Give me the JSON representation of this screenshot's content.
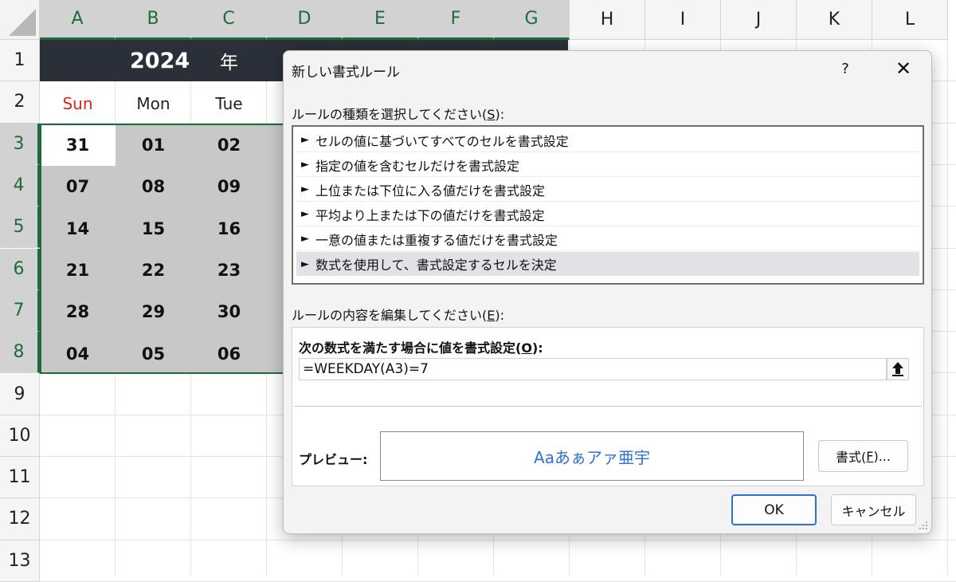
{
  "sheet": {
    "columns": [
      "A",
      "B",
      "C",
      "D",
      "E",
      "F",
      "G",
      "H",
      "I",
      "J",
      "K",
      "L"
    ],
    "rows": [
      "1",
      "2",
      "3",
      "4",
      "5",
      "6",
      "7",
      "8",
      "9",
      "10",
      "11",
      "12",
      "13"
    ],
    "year": "2024",
    "year_suffix": "年",
    "weekdays": [
      "Sun",
      "Mon",
      "Tue"
    ],
    "day_rows": [
      [
        "31",
        "01",
        "02"
      ],
      [
        "07",
        "08",
        "09"
      ],
      [
        "14",
        "15",
        "16"
      ],
      [
        "21",
        "22",
        "23"
      ],
      [
        "28",
        "29",
        "30"
      ],
      [
        "04",
        "05",
        "06"
      ]
    ],
    "colors": {
      "header_band": "#2b2f38",
      "selection": "#1e6b3a",
      "sunday": "#e02020",
      "range_fill": "#c8c8c8"
    }
  },
  "dialog": {
    "title": "新しい書式ルール",
    "help": "?",
    "close": "✕",
    "rule_type_label_pre": "ルールの種類を選択してください(",
    "rule_type_key": "S",
    "rule_type_label_post": "):",
    "rule_types": [
      "セルの値に基づいてすべてのセルを書式設定",
      "指定の値を含むセルだけを書式設定",
      "上位または下位に入る値だけを書式設定",
      "平均より上または下の値だけを書式設定",
      "一意の値または重複する値だけを書式設定",
      "数式を使用して、書式設定するセルを決定"
    ],
    "rule_arrow": "►",
    "selected_rule": "数式を使用して、書式設定するセルを決定",
    "edit_label_pre": "ルールの内容を編集してください(",
    "edit_key": "E",
    "edit_label_post": "):",
    "formula_label_pre": "次の数式を満たす場合に値を書式設定(",
    "formula_key": "O",
    "formula_label_post": "):",
    "formula_value": "=WEEKDAY(A3)=7",
    "preview_label": "プレビュー:",
    "preview_text": "Aaあぁアァ亜宇",
    "format_button_pre": "書式(",
    "format_key": "F",
    "format_button_post": ")...",
    "ok": "OK",
    "cancel": "キャンセル",
    "colors": {
      "preview_text": "#2f6fd8",
      "ok_border": "#2f6fd8"
    }
  }
}
